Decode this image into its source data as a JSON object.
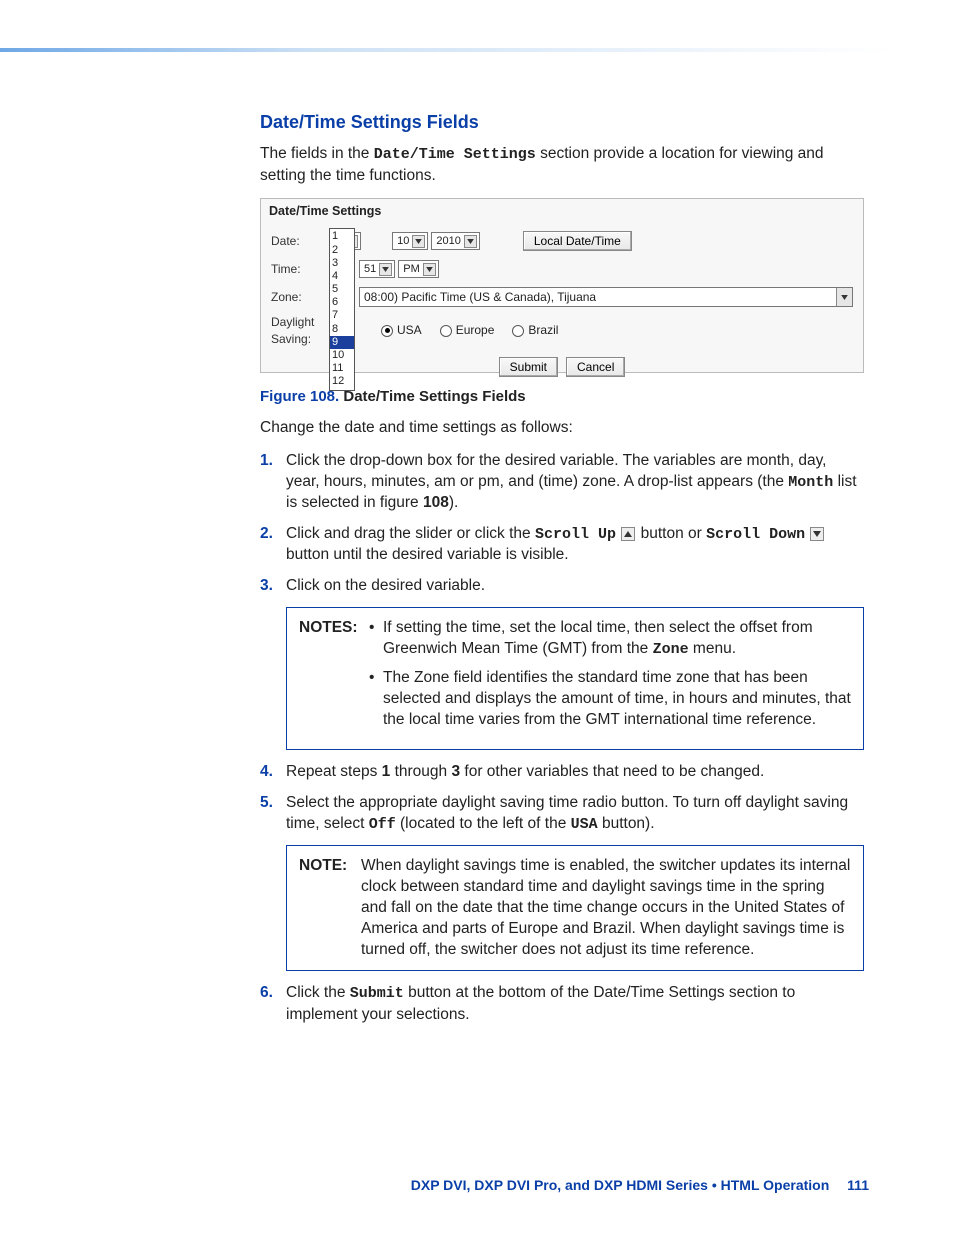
{
  "heading": "Date/Time Settings Fields",
  "intro_1": "The fields in the ",
  "intro_code": "Date/Time Settings",
  "intro_2": " section provide a location for viewing and setting the time functions.",
  "panel": {
    "title": "Date/Time Settings",
    "labels": {
      "date": "Date:",
      "time": "Time:",
      "zone": "Zone:",
      "dst": "Daylight Saving:"
    },
    "date": {
      "month": "9",
      "day": "10",
      "year": "2010"
    },
    "localbtn": "Local Date/Time",
    "time": {
      "minute": "51",
      "ampm": "PM"
    },
    "zone_text": "08:00) Pacific Time (US & Canada), Tijuana",
    "radios": {
      "usa": "USA",
      "europe": "Europe",
      "brazil": "Brazil"
    },
    "submit": "Submit",
    "cancel": "Cancel",
    "monthlist": [
      "1",
      "2",
      "3",
      "4",
      "5",
      "6",
      "7",
      "8",
      "9",
      "10",
      "11",
      "12"
    ],
    "month_selected": "9"
  },
  "figcap_num": "Figure 108. ",
  "figcap_text": "Date/Time Settings Fields",
  "changeline": "Change the date and time settings as follows:",
  "steps": {
    "s1": "Click the drop-down box for the desired variable. The variables are month, day, year, hours, minutes, am or pm, and (time) zone. A drop-list appears (the ",
    "s1_code": "Month",
    "s1_b": " list is selected in figure ",
    "s1_num": "108",
    "s1_c": ").",
    "s2a": "Click and drag the slider or click the ",
    "s2_up": "Scroll Up",
    "s2b": " button or ",
    "s2_down": "Scroll Down",
    "s2c": " button until the desired variable is visible.",
    "s3": "Click on the desired variable.",
    "s4a": "Repeat steps ",
    "s4b": " through ",
    "s4c": " for other variables that need to be changed.",
    "s4_1": "1",
    "s4_3": "3",
    "s5a": "Select the appropriate daylight saving time radio button. To turn off daylight saving time, select ",
    "s5_off": "Off",
    "s5b": " (located to the left of the ",
    "s5_usa": "USA",
    "s5c": " button).",
    "s6a": "Click the ",
    "s6_submit": "Submit",
    "s6b": " button at the bottom of the Date/Time Settings section to implement your selections."
  },
  "notes1_label": "NOTES:",
  "notes1": {
    "a1": "If setting the time, set the local time, then select the offset from Greenwich Mean Time (GMT) from the ",
    "a_code": "Zone",
    "a2": " menu.",
    "b": "The Zone field identifies the standard time zone that has been selected and displays the amount of time, in hours and minutes, that the local time varies from the GMT international time reference."
  },
  "note2_label": "NOTE:",
  "note2_body": "When daylight savings time is enabled, the switcher updates its internal clock between standard time and daylight savings time in the spring and fall on the date that the time change occurs in the United States of America and parts of Europe and Brazil. When daylight savings time is turned off, the switcher does not adjust its time reference.",
  "footer_text": "DXP DVI, DXP DVI Pro, and DXP HDMI Series • HTML Operation",
  "footer_page": "111"
}
